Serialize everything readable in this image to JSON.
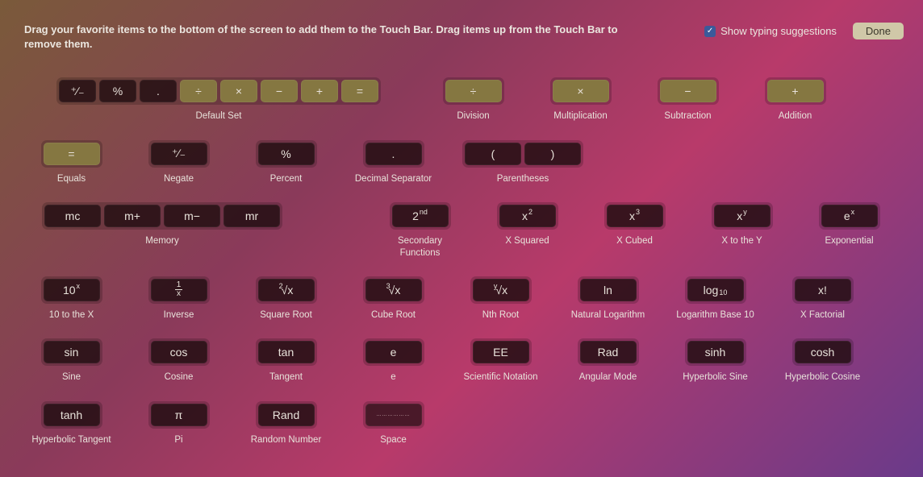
{
  "header": {
    "instructions": "Drag your favorite items to the bottom of the screen to add them to the Touch Bar. Drag items up from the Touch Bar to remove them.",
    "show_typing_label": "Show typing suggestions",
    "done_label": "Done"
  },
  "glyphs": {
    "plusminus": "⁺∕₋",
    "percent": "%",
    "dot": ".",
    "divide": "÷",
    "multiply": "×",
    "minus": "−",
    "plus": "+",
    "equals": "=",
    "lparen": "(",
    "rparen": ")",
    "mc": "mc",
    "mplus": "m+",
    "mminus": "m−",
    "mr": "mr",
    "second": "2",
    "second_sup": "nd",
    "x2_base": "x",
    "x2_sup": "2",
    "x3_base": "x",
    "x3_sup": "3",
    "xy_base": "x",
    "xy_sup": "y",
    "ex_base": "e",
    "ex_sup": "x",
    "tenx_base": "10",
    "tenx_sup": "x",
    "inv_top": "1",
    "inv_bot": "x",
    "sqrt_pre": "2",
    "sqrt_body": "√x",
    "cbrt_pre": "3",
    "cbrt_body": "√x",
    "nroot_pre": "y",
    "nroot_body": "√x",
    "ln": "ln",
    "log10_base": "log",
    "log10_sub": "10",
    "xfact": "x!",
    "sin": "sin",
    "cos": "cos",
    "tan": "tan",
    "e": "e",
    "EE": "EE",
    "rad": "Rad",
    "sinh": "sinh",
    "cosh": "cosh",
    "tanh": "tanh",
    "pi": "π",
    "rand": "Rand",
    "space_dots": "………………"
  },
  "labels": {
    "default_set": "Default Set",
    "division": "Division",
    "multiplication": "Multiplication",
    "subtraction": "Subtraction",
    "addition": "Addition",
    "equals": "Equals",
    "negate": "Negate",
    "percent": "Percent",
    "decimal": "Decimal Separator",
    "parentheses": "Parentheses",
    "memory": "Memory",
    "secondary": "Secondary Functions",
    "xsquared": "X Squared",
    "xcubed": "X Cubed",
    "xtoy": "X to the Y",
    "exponential": "Exponential",
    "tentox": "10 to the X",
    "inverse": "Inverse",
    "sqrt": "Square Root",
    "cbrt": "Cube Root",
    "nroot": "Nth Root",
    "ln": "Natural Logarithm",
    "log10": "Logarithm Base 10",
    "xfact": "X Factorial",
    "sine": "Sine",
    "cosine": "Cosine",
    "tangent": "Tangent",
    "e": "e",
    "scinot": "Scientific Notation",
    "angmode": "Angular Mode",
    "sinh": "Hyperbolic Sine",
    "cosh": "Hyperbolic Cosine",
    "tanh": "Hyperbolic Tangent",
    "pi": "Pi",
    "rand": "Random Number",
    "space": "Space"
  }
}
